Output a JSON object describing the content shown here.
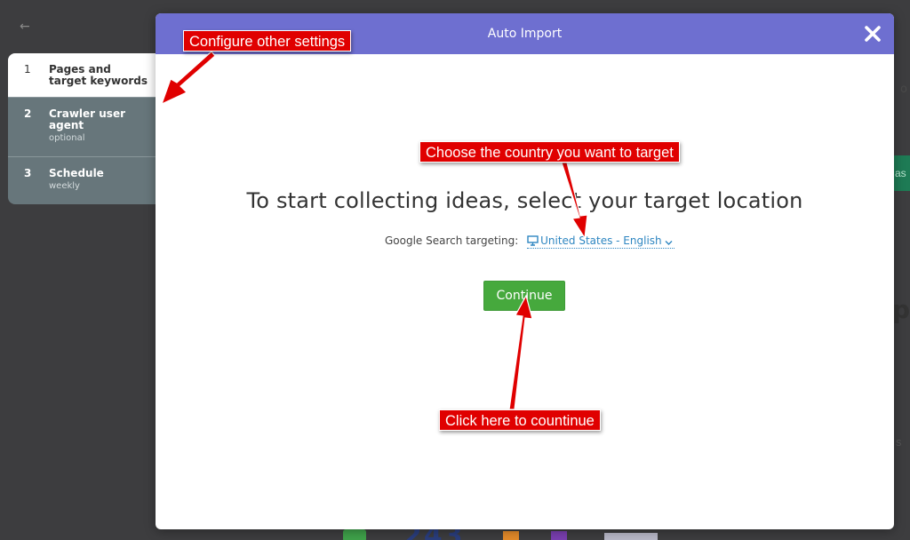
{
  "background": {
    "back_glyph": "←",
    "fragment_o": "o",
    "green_button_fragment": "as",
    "fragment_p": "p",
    "fragment_s": "s"
  },
  "steps": [
    {
      "num": "1",
      "title": "Pages and target keywords",
      "subtitle": "",
      "active": true
    },
    {
      "num": "2",
      "title": "Crawler user agent",
      "subtitle": "optional",
      "active": false
    },
    {
      "num": "3",
      "title": "Schedule",
      "subtitle": "weekly",
      "active": false
    }
  ],
  "modal": {
    "title": "Auto Import",
    "close_icon": "close-icon",
    "heading": "To start collecting ideas, select your target location",
    "targeting_label": "Google Search targeting:",
    "targeting_value": "United States - English",
    "targeting_icon": "desktop-icon",
    "continue_label": "Continue"
  },
  "annotations": {
    "configure": "Configure other settings",
    "country": "Choose the country you want to target",
    "continue_hint": "Click here to countinue"
  },
  "colors": {
    "header": "#6e6fd0",
    "continue": "#46a93d",
    "link": "#2e86c1",
    "callout": "#e00000"
  }
}
